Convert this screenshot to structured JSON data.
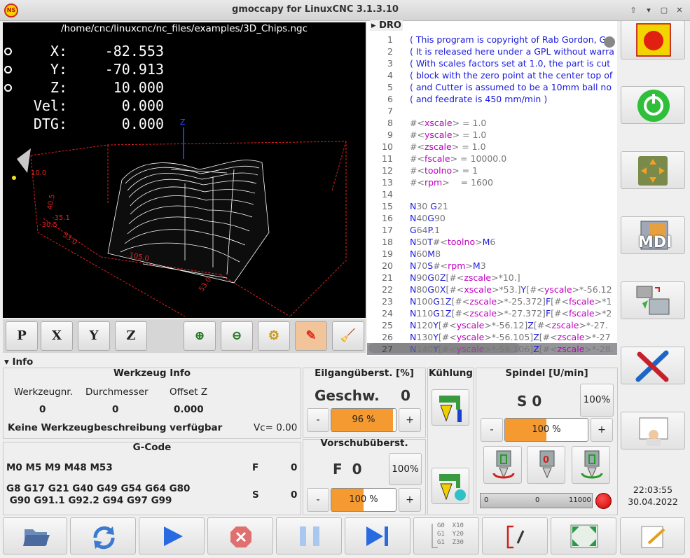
{
  "window": {
    "title": "gmoccapy for LinuxCNC  3.1.3.10",
    "logo_text": "NS"
  },
  "preview": {
    "file_path": "/home/cnc/linuxcnc/nc_files/examples/3D_Chips.ngc",
    "dro": [
      {
        "axis": "X:",
        "value": "-82.553"
      },
      {
        "axis": "Y:",
        "value": "-70.913"
      },
      {
        "axis": "Z:",
        "value": "10.000"
      },
      {
        "axis": "Vel:",
        "value": "0.000"
      },
      {
        "axis": "DTG:",
        "value": "0.000"
      }
    ],
    "dims": {
      "a": "10.0",
      "b": "40.5",
      "c": "-35.1",
      "d": "-30.5",
      "e": "53.0",
      "f": "105.0",
      "g": "53.0",
      "z": "Z"
    }
  },
  "view_buttons": {
    "p": "P",
    "x": "X",
    "y": "Y",
    "z": "Z"
  },
  "code": {
    "header": "DRO",
    "lines": [
      {
        "n": "1",
        "t": "( This program is copyright of Rab Gordon, Ga"
      },
      {
        "n": "2",
        "t": "( It is released here under a GPL without warra"
      },
      {
        "n": "3",
        "t": "( With scales factors set at 1.0, the part is cut"
      },
      {
        "n": "4",
        "t": "( block with the zero point at the center top of"
      },
      {
        "n": "5",
        "t": "( and Cutter is assumed to be a 10mm ball no"
      },
      {
        "n": "6",
        "t": "( and feedrate is 450 mm/min )"
      },
      {
        "n": "7",
        "t": ""
      },
      {
        "n": "8",
        "t": "#<xscale> = 1.0"
      },
      {
        "n": "9",
        "t": "#<yscale> = 1.0"
      },
      {
        "n": "10",
        "t": "#<zscale> = 1.0"
      },
      {
        "n": "11",
        "t": "#<fscale> = 10000.0"
      },
      {
        "n": "12",
        "t": "#<toolno> = 1"
      },
      {
        "n": "13",
        "t": "#<rpm>    = 1600"
      },
      {
        "n": "14",
        "t": ""
      },
      {
        "n": "15",
        "t": "N30 G21"
      },
      {
        "n": "16",
        "t": "N40G90"
      },
      {
        "n": "17",
        "t": "G64P.1"
      },
      {
        "n": "18",
        "t": "N50T#<toolno>M6"
      },
      {
        "n": "19",
        "t": "N60M8"
      },
      {
        "n": "20",
        "t": "N70S#<rpm>M3"
      },
      {
        "n": "21",
        "t": "N90G0Z[#<zscale>*10.]"
      },
      {
        "n": "22",
        "t": "N80G0X[#<xscale>*53.]Y[#<yscale>*-56.12"
      },
      {
        "n": "23",
        "t": "N100G1Z[#<zscale>*-25.372]F[#<fscale>*1"
      },
      {
        "n": "24",
        "t": "N110G1Z[#<zscale>*-27.372]F[#<fscale>*2"
      },
      {
        "n": "25",
        "t": "N120Y[#<yscale>*-56.12]Z[#<zscale>*-27."
      },
      {
        "n": "26",
        "t": "N130Y[#<yscale>*-56.105]Z[#<zscale>*-27"
      },
      {
        "n": "27",
        "t": "N140Y[#<yscale>*-56.106]Z[#<zscale>*-28."
      }
    ]
  },
  "info": {
    "toggle_label": "Info",
    "tool": {
      "title": "Werkzeug Info",
      "col1_label": "Werkzeugnr.",
      "col1_value": "0",
      "col2_label": "Durchmesser",
      "col2_value": "0",
      "col3_label": "Offset Z",
      "col3_value": "0.000",
      "description": "Keine Werkzeugbeschreibung verfügbar",
      "vc": "Vc= 0.00"
    },
    "gcode": {
      "title": "G-Code",
      "mcodes": "M0 M5 M9 M48 M53",
      "gcodes_1": "G8 G17 G21 G40 G49 G54 G64 G80",
      "gcodes_2": " G90 G91.1 G92.2 G94 G97 G99",
      "f_label": "F",
      "f_value": "0",
      "s_label": "S",
      "s_value": "0"
    },
    "rapid": {
      "title": "Eilgangüberst. [%]",
      "label": "Geschw.",
      "value": "0",
      "percent_text": "96 %",
      "percent": 96,
      "minus": "-",
      "plus": "+"
    },
    "feed": {
      "title": "Vorschubüberst.",
      "label": "F  0",
      "reset": "100%",
      "percent_text": "100 %",
      "percent": 100,
      "minus": "-",
      "plus": "+"
    },
    "cooling": {
      "title": "Kühlung"
    },
    "spindle": {
      "title": "Spindel [U/min]",
      "label": "S 0",
      "reset": "100%",
      "percent_text": "100 %",
      "percent": 100,
      "minus": "-",
      "plus": "+",
      "stop_label": "0",
      "bar_min": "0",
      "bar_mid": "0",
      "bar_max": "11000"
    }
  },
  "clock": {
    "time": "22:03:55",
    "date": "30.04.2022"
  },
  "bottom": {
    "gcode_btn_1": "G0  X10",
    "gcode_btn_2": "G1  Y20",
    "gcode_btn_3": "G1  Z30"
  },
  "side": {
    "mdi_label": "MDI"
  },
  "colors": {
    "accent": "#f59a30",
    "code_keyword": "#1a1ae0",
    "code_variable": "#c000c0",
    "code_comment": "#1a1ae0",
    "code_number": "#777777",
    "toolpath": "#ffffff",
    "bbox": "#e02020"
  }
}
